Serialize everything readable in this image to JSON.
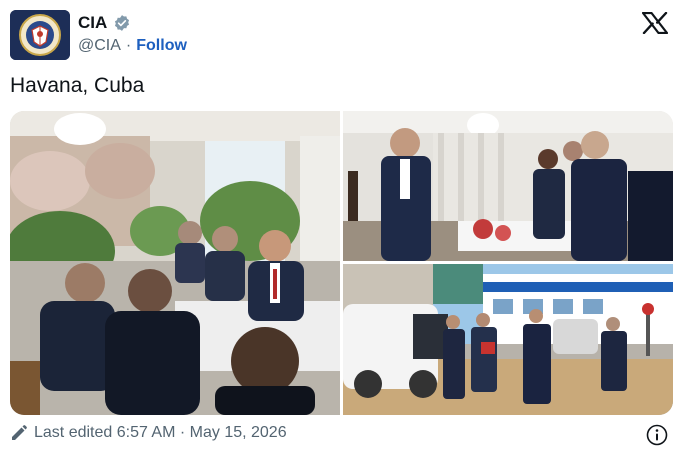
{
  "account": {
    "name": "CIA",
    "handle": "@CIA",
    "separator": "·",
    "follow_label": "Follow",
    "avatar_seal_text": "CENTRAL INTELLIGENCE AGENCY"
  },
  "tweet": {
    "text": "Havana, Cuba"
  },
  "footer": {
    "edited_text": "Last edited 6:57 AM · May 15, 2026"
  },
  "colors": {
    "follow": "#1d5fbf",
    "verified_badge": "#829aab",
    "muted_text": "#536471"
  },
  "icons": {
    "verified": "verified-badge-icon",
    "platform": "x-logo-icon",
    "edit": "pencil-icon",
    "info": "info-icon"
  }
}
